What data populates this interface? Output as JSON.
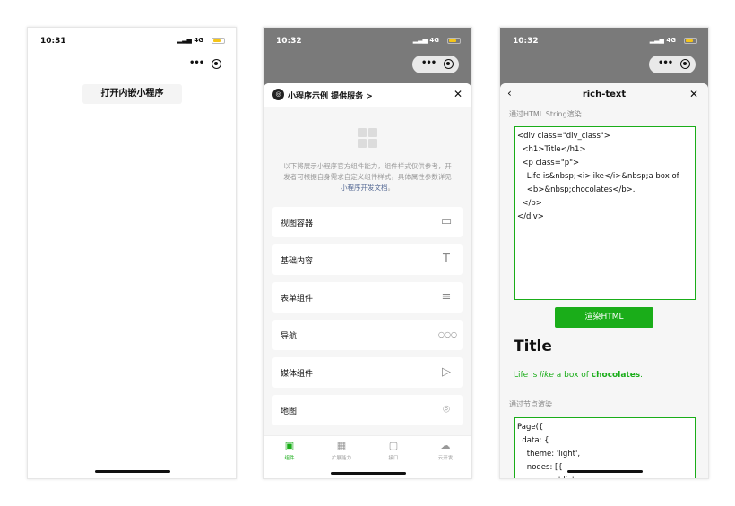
{
  "phone1": {
    "status": {
      "time": "10:31",
      "signal": "4G"
    },
    "open_button": "打开内嵌小程序"
  },
  "phone2": {
    "status": {
      "time": "10:32",
      "signal": "4G"
    },
    "header": {
      "brand": "小程序示例 提供服务 >"
    },
    "intro": {
      "text": "以下将展示小程序官方组件能力，组件样式仅供参考，开发者可根据自身需求自定义组件样式，具体属性参数详见",
      "link": "小程序开发文档",
      "end": "。"
    },
    "menu": [
      {
        "label": "视图容器",
        "icon": "container-icon"
      },
      {
        "label": "基础内容",
        "icon": "text-icon"
      },
      {
        "label": "表单组件",
        "icon": "list-icon"
      },
      {
        "label": "导航",
        "icon": "dots-icon"
      },
      {
        "label": "媒体组件",
        "icon": "play-icon"
      },
      {
        "label": "地图",
        "icon": "location-icon"
      }
    ],
    "tabs": [
      {
        "label": "组件",
        "active": true
      },
      {
        "label": "扩展能力",
        "active": false
      },
      {
        "label": "接口",
        "active": false
      },
      {
        "label": "云开发",
        "active": false
      }
    ]
  },
  "phone3": {
    "status": {
      "time": "10:32",
      "signal": "4G"
    },
    "header": {
      "title": "rich-text"
    },
    "section1_label": "通过HTML String渲染",
    "html_code": "<div class=\"div_class\">\n  <h1>Title</h1>\n  <p class=\"p\">\n    Life is&nbsp;<i>like</i>&nbsp;a box of\n    <b>&nbsp;chocolates</b>.\n  </p>\n</div>",
    "render_button": "渲染HTML",
    "rendered": {
      "title": "Title",
      "p_part1": "Life is ",
      "p_italic": "like",
      "p_part2": " a box of ",
      "p_bold": "chocolates",
      "p_end": "."
    },
    "section2_label": "通过节点渲染",
    "node_code": "Page({\n  data: {\n    theme: 'light',\n    nodes: [{\n      name: 'div',"
  },
  "colors": {
    "accent": "#1aad19",
    "link": "#576b95",
    "overlay": "#7a7a7a"
  }
}
